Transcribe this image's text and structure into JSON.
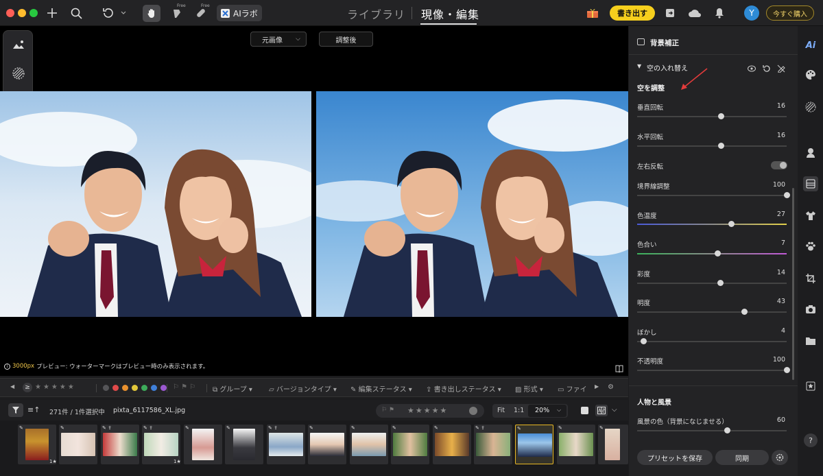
{
  "topbar": {
    "free_badge": "Free",
    "ai_lab_label": "AIラボ",
    "tabs": [
      "ライブラリ",
      "現像・編集"
    ],
    "export_button": "書き出す",
    "avatar_initial": "Y",
    "buy_button": "今すぐ購入"
  },
  "viewer": {
    "source_select": "元画像",
    "after_button": "調整後",
    "info_px": "3000px",
    "info_text": "プレビュー: ウォーターマークはプレビュー時のみ表示されます。"
  },
  "filterbar": {
    "group": "グループ",
    "version_type": "バージョンタイプ",
    "edit_status": "編集ステータス",
    "export_status": "書き出しステータス",
    "format": "形式",
    "file": "ファイ",
    "label_colors": [
      "#555558",
      "#e04a4a",
      "#e8902e",
      "#e2c73a",
      "#3dab5a",
      "#3f7fd8",
      "#9b59d0"
    ]
  },
  "countbar": {
    "count": "271件 / 1件選択中",
    "filename": "pixta_6117586_XL.jpg",
    "fit": "Fit",
    "one_to_one": "1:1",
    "zoom": "20%"
  },
  "filmstrip": {
    "badges": [
      "1★",
      "1★"
    ]
  },
  "panel": {
    "header": "背景補正",
    "section": "空の入れ替え",
    "sub_header": "空を調整",
    "sliders": [
      {
        "label": "垂直回転",
        "value": "16",
        "pos": 0.56
      },
      {
        "label": "水平回転",
        "value": "16",
        "pos": 0.56
      },
      {
        "label": "境界線調整",
        "value": "100",
        "pos": 1.0
      },
      {
        "label": "色温度",
        "value": "27",
        "pos": 0.63
      },
      {
        "label": "色合い",
        "value": "7",
        "pos": 0.535
      },
      {
        "label": "彩度",
        "value": "14",
        "pos": 0.555
      },
      {
        "label": "明度",
        "value": "43",
        "pos": 0.715
      },
      {
        "label": "ぼかし",
        "value": "4",
        "pos": 0.04
      },
      {
        "label": "不透明度",
        "value": "100",
        "pos": 1.0
      }
    ],
    "toggle_label": "左右反転",
    "section2": "人物と風景",
    "bg_color_label": "風景の色（背景になじませる）",
    "bg_color_value": "60",
    "bg_color_pos": 0.6,
    "save_preset": "プリセットを保存",
    "sync": "同期"
  },
  "rightbar": {
    "ai_label": "Ai",
    "help": "?"
  }
}
